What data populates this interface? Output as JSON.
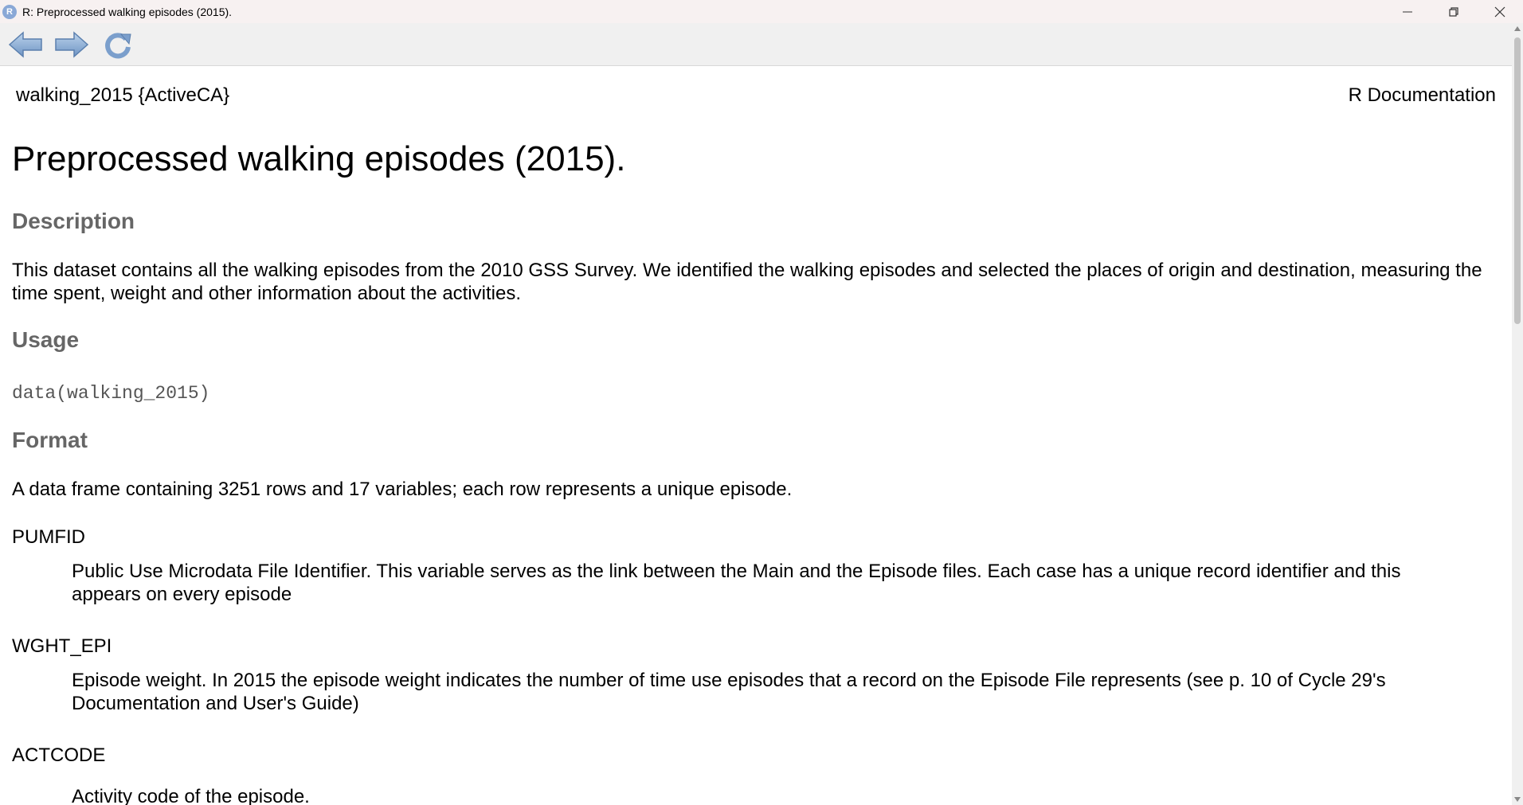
{
  "window": {
    "title": "R: Preprocessed walking episodes (2015).",
    "app_icon_letter": "R",
    "icons": {
      "minimize": "minimize-icon",
      "restore": "restore-icon",
      "close": "close-icon"
    }
  },
  "toolbar": {
    "icons": [
      "back-arrow-icon",
      "forward-arrow-icon",
      "refresh-icon"
    ]
  },
  "doc": {
    "header_left": "walking_2015 {ActiveCA}",
    "header_right": "R Documentation",
    "title": "Preprocessed walking episodes (2015).",
    "description_heading": "Description",
    "description_text": "This dataset contains all the walking episodes from the 2010 GSS Survey. We identified the walking episodes and selected the places of origin and destination, measuring the time spent, weight and other information about the activities.",
    "usage_heading": "Usage",
    "usage_code": "data(walking_2015)",
    "format_heading": "Format",
    "format_text": "A data frame containing 3251 rows and 17 variables; each row represents a unique episode.",
    "variables": [
      {
        "name": "PUMFID",
        "desc": "Public Use Microdata File Identifier. This variable serves as the link between the Main and the Episode files. Each case has a unique record identifier and this appears on every episode"
      },
      {
        "name": "WGHT_EPI",
        "desc": "Episode weight. In 2015 the episode weight indicates the number of time use episodes that a record on the Episode File represents (see p. 10 of Cycle 29's Documentation and User's Guide)"
      },
      {
        "name": "ACTCODE",
        "desc": "Activity code of the episode."
      }
    ]
  }
}
